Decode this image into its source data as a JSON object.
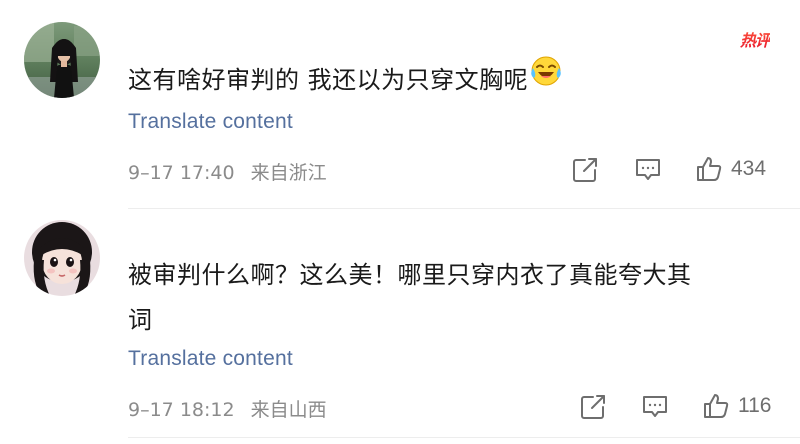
{
  "badge": {
    "hot": "热评"
  },
  "comments": [
    {
      "text": "这有啥好审判的 我还以为只穿文胸呢",
      "emoji": "crying-laughing-emoji",
      "translate": "Translate content",
      "date": "9–17",
      "time": "17:40",
      "location": "来自浙江",
      "likes": "434"
    },
    {
      "text_line1": "被审判什么啊？这么美！哪里只穿内衣了真能夸大其",
      "text_line2": "词",
      "translate": "Translate content",
      "date": "9–17",
      "time": "18:12",
      "location": "来自山西",
      "likes": "116"
    }
  ],
  "colors": {
    "translate_link": "#55709e",
    "meta_text": "#8b8b8b",
    "icon_gray": "#6e6e6e",
    "hot_badge": "#e8142c"
  }
}
